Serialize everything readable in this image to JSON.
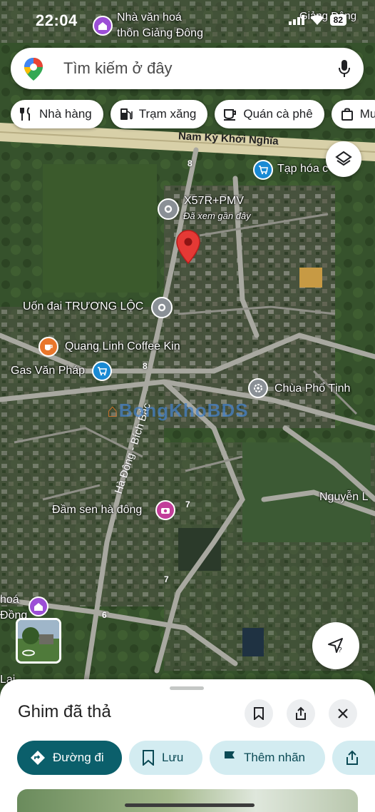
{
  "status_bar": {
    "time": "22:04",
    "battery": "82"
  },
  "search": {
    "placeholder": "Tìm kiếm ở đây"
  },
  "chips": [
    {
      "label": "Nhà hàng",
      "icon": "restaurant-icon"
    },
    {
      "label": "Trạm xăng",
      "icon": "gas-station-icon"
    },
    {
      "label": "Quán cà phê",
      "icon": "coffee-icon"
    },
    {
      "label": "Mu",
      "icon": "shopping-bag-icon"
    }
  ],
  "map": {
    "roads": {
      "main": "Nam Kỳ Khởi Nghĩa",
      "side": "Hà Đông - Bích Bắc",
      "right": "Nguyễn L",
      "numbers": [
        "8",
        "8",
        "7",
        "7",
        "6"
      ]
    },
    "places": [
      {
        "name": "Nhà văn hoá\nthôn Giảng Đông",
        "icon": "community-hall-icon"
      },
      {
        "name": "Tạp hóa c",
        "icon": "shopping-cart-icon"
      },
      {
        "name": "X57R+PMV",
        "sub": "Đã xem gần đây",
        "icon": "recent-pin-icon"
      },
      {
        "name": "Uốn đai TRƯƠNG LỘC",
        "icon": "place-pin-icon"
      },
      {
        "name": "Quang Linh Coffee Kin",
        "icon": "coffee-icon"
      },
      {
        "name": "Gas Văn Pháp",
        "icon": "shopping-cart-icon"
      },
      {
        "name": "Chùa Phổ Tịnh",
        "icon": "temple-icon"
      },
      {
        "name": "Đầm sen hà đông",
        "icon": "camera-icon"
      },
      {
        "name": "hoá\nĐồng",
        "icon": "community-hall-icon"
      },
      {
        "name": "Lai",
        "icon": ""
      }
    ],
    "top_right_fragment": "Giảng Đông",
    "watermark": "BongKhoBDS"
  },
  "sheet": {
    "title": "Ghim đã thả",
    "actions": [
      {
        "label": "Đường đi",
        "icon": "directions-icon"
      },
      {
        "label": "Lưu",
        "icon": "bookmark-icon"
      },
      {
        "label": "Thêm nhãn",
        "icon": "flag-icon"
      },
      {
        "label": "",
        "icon": "share-icon"
      }
    ]
  },
  "colors": {
    "primary": "#0b5f6b",
    "secondary": "#d3ecf1",
    "pin": "#e53935"
  }
}
